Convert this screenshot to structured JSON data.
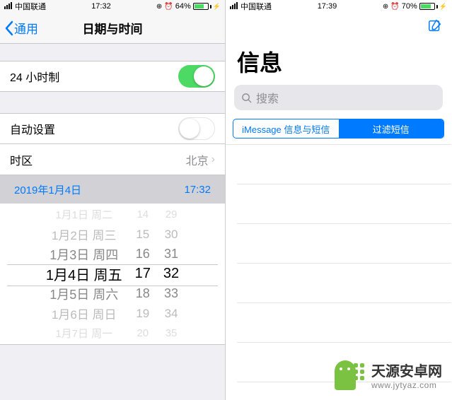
{
  "left": {
    "status": {
      "carrier": "中国联通",
      "time": "17:32",
      "battery_pct": "64%",
      "battery_fill": 64
    },
    "nav": {
      "back": "通用",
      "title": "日期与时间"
    },
    "rows": {
      "24h_label": "24 小时制",
      "auto_label": "自动设置",
      "tz_label": "时区",
      "tz_value": "北京"
    },
    "summary": {
      "date": "2019年1月4日",
      "time": "17:32"
    },
    "picker": {
      "date_col": [
        "1月1日 周二",
        "1月2日 周三",
        "1月3日 周四",
        "1月4日 周五",
        "1月5日 周六",
        "1月6日 周日",
        "1月7日 周一"
      ],
      "hour_col": [
        "14",
        "15",
        "16",
        "17",
        "18",
        "19",
        "20"
      ],
      "min_col": [
        "29",
        "30",
        "31",
        "32",
        "33",
        "34",
        "35"
      ]
    }
  },
  "right": {
    "status": {
      "carrier": "中国联通",
      "time": "17:39",
      "battery_pct": "70%",
      "battery_fill": 70
    },
    "title": "信息",
    "search_placeholder": "搜索",
    "seg": {
      "a": "iMessage 信息与短信",
      "b": "过滤短信"
    }
  },
  "watermark": {
    "name": "天源安卓网",
    "url": "www.jytyaz.com"
  }
}
